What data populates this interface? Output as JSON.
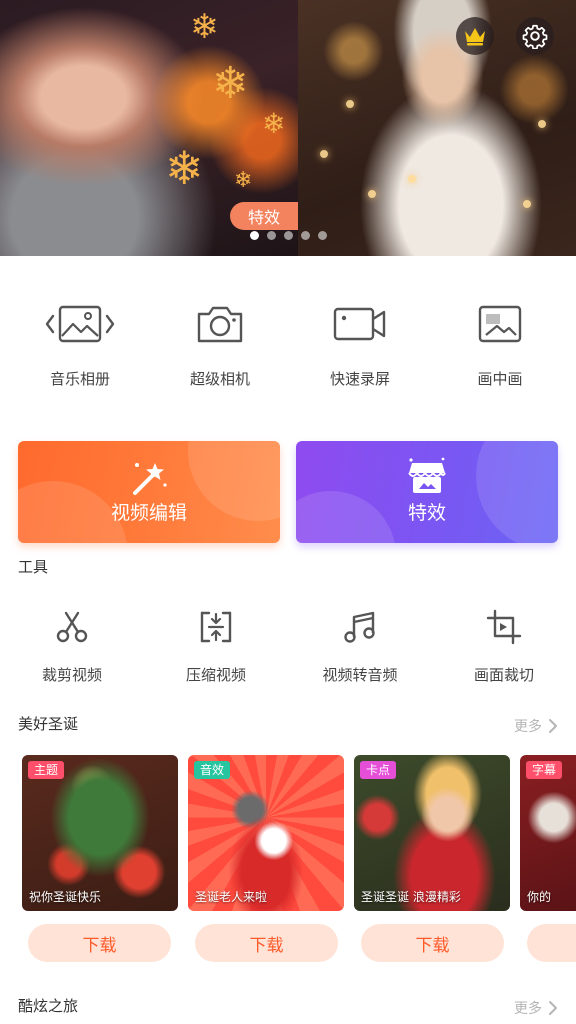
{
  "banner": {
    "tag": "特效",
    "dots_count": 5,
    "active_dot": 0
  },
  "quick_tools": [
    {
      "label": "音乐相册",
      "icon": "music-album-icon"
    },
    {
      "label": "超级相机",
      "icon": "camera-icon"
    },
    {
      "label": "快速录屏",
      "icon": "screen-record-icon"
    },
    {
      "label": "画中画",
      "icon": "picture-in-picture-icon"
    }
  ],
  "cards": {
    "video_edit": {
      "label": "视频编辑",
      "icon": "magic-wand-icon",
      "color": "#ff7033"
    },
    "effects": {
      "label": "特效",
      "icon": "store-icon",
      "color": "#8050f0"
    }
  },
  "tools_section": {
    "title": "工具",
    "items": [
      {
        "label": "裁剪视频",
        "icon": "scissors-icon"
      },
      {
        "label": "压缩视频",
        "icon": "compress-icon"
      },
      {
        "label": "视频转音频",
        "icon": "music-note-icon"
      },
      {
        "label": "画面裁切",
        "icon": "crop-icon"
      }
    ]
  },
  "christmas_section": {
    "title": "美好圣诞",
    "more": "更多",
    "templates": [
      {
        "badge": "主题",
        "badge_color": "#ff4f6a",
        "caption": "祝你圣诞快乐",
        "download": "下载"
      },
      {
        "badge": "音效",
        "badge_color": "#27c4a0",
        "caption": "圣诞老人来啦",
        "download": "下载"
      },
      {
        "badge": "卡点",
        "badge_color": "#e54fd8",
        "caption": "圣诞圣诞 浪漫精彩",
        "download": "下载"
      },
      {
        "badge": "字幕",
        "badge_color": "#ff4f6a",
        "caption": "你的",
        "download": ""
      }
    ]
  },
  "travel_section": {
    "title": "酷炫之旅",
    "more": "更多"
  }
}
